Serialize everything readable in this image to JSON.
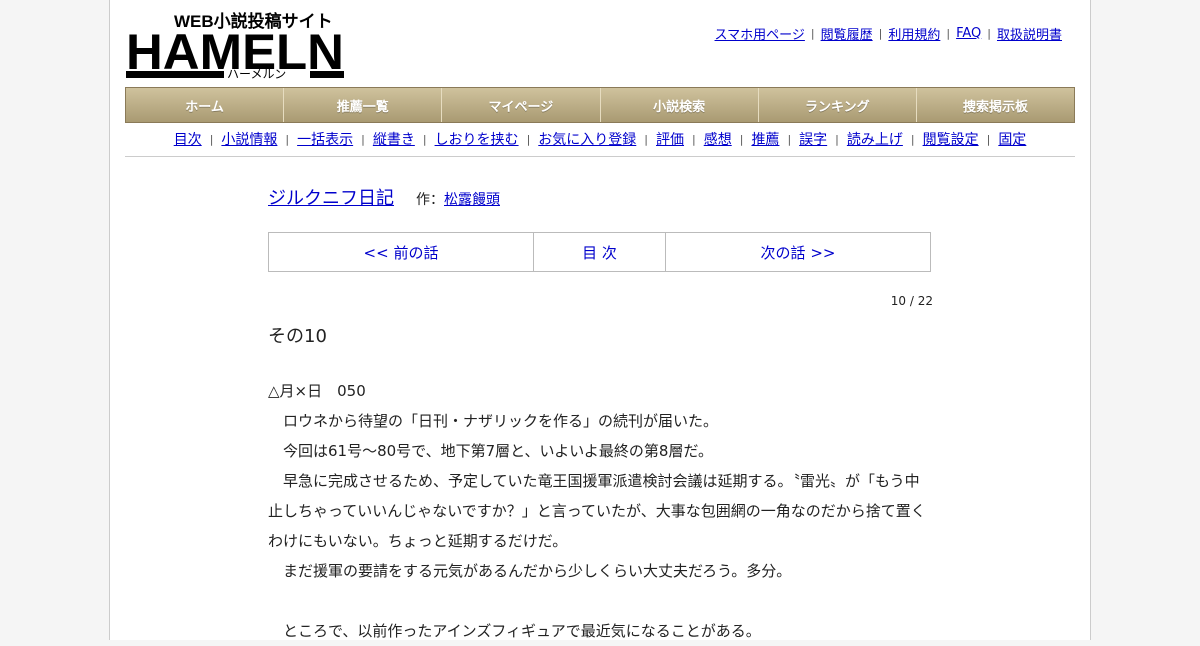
{
  "site": {
    "logo_text": "HAMELN",
    "logo_subtitle": "WEB小説投稿サイト",
    "logo_kana": "ハーメルン"
  },
  "top_links": [
    "スマホ用ページ",
    "閲覧履歴",
    "利用規約",
    "FAQ",
    "取扱説明書"
  ],
  "main_nav": [
    "ホーム",
    "推薦一覧",
    "マイページ",
    "小説検索",
    "ランキング",
    "捜索掲示板"
  ],
  "sub_nav": [
    "目次",
    "小説情報",
    "一括表示",
    "縦書き",
    "しおりを挟む",
    "お気に入り登録",
    "評価",
    "感想",
    "推薦",
    "誤字",
    "読み上げ",
    "閲覧設定",
    "固定"
  ],
  "novel": {
    "title": "ジルクニフ日記",
    "author_label": "作：",
    "author": "松露饅頭"
  },
  "episode_nav": {
    "prev": "<< 前の話",
    "toc": "目 次",
    "next": "次の話 >>"
  },
  "counter": "10 / 22",
  "episode_title": "その10",
  "body_lines": [
    "",
    "△月×日　050",
    "　ロウネから待望の「日刊・ナザリックを作る」の続刊が届いた。",
    "　今回は61号～80号で、地下第7層と、いよいよ最終の第8層だ。",
    "　早急に完成させるため、予定していた竜王国援軍派遣検討会議は延期する。〝雷光〟が「もう中",
    "止しちゃっていいんじゃないですか？」と言っていたが、大事な包囲網の一角なのだから捨て置く",
    "わけにもいない。ちょっと延期するだけだ。",
    "　まだ援軍の要請をする元気があるんだから少しくらい大丈夫だろう。多分。",
    "",
    "　ところで、以前作ったアインズフィギュアで最近気になることがある。"
  ]
}
